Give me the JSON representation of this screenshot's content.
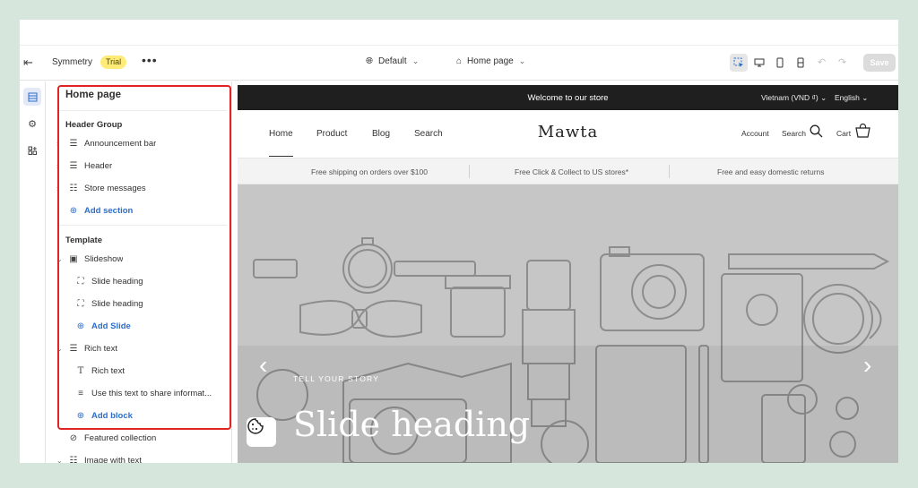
{
  "topbar": {
    "store_name": "Symmetry",
    "badge": "Trial",
    "more": "•••",
    "theme_select": "Default",
    "page_select": "Home page",
    "save_label": "Save",
    "icons": [
      "exit-icon",
      "globe-icon",
      "home-icon",
      "inspector-icon",
      "desktop-icon",
      "mobile-icon",
      "fullscreen-icon",
      "undo-icon",
      "redo-icon"
    ]
  },
  "panel": {
    "title": "Home page",
    "header_group": {
      "label": "Header Group",
      "items": [
        {
          "label": "Announcement bar",
          "icon": "announcement-icon"
        },
        {
          "label": "Header",
          "icon": "header-icon"
        },
        {
          "label": "Store messages",
          "icon": "store-messages-icon"
        }
      ],
      "add_label": "Add section"
    },
    "template": {
      "label": "Template",
      "slideshow": {
        "label": "Slideshow",
        "children": [
          "Slide heading",
          "Slide heading"
        ],
        "add_label": "Add Slide"
      },
      "rich_text": {
        "label": "Rich text",
        "children": [
          "Rich text",
          "Use this text to share informat..."
        ],
        "add_label": "Add block"
      },
      "more_sections": [
        "Featured collection",
        "Image with text"
      ]
    }
  },
  "preview": {
    "announcement": "Welcome to our store",
    "locale": "Vietnam (VND ₫)",
    "language": "English",
    "nav": [
      "Home",
      "Product",
      "Blog",
      "Search"
    ],
    "logo": "Mawta",
    "account": "Account",
    "search": "Search",
    "cart": "Cart",
    "usps": [
      "Free shipping on orders over $100",
      "Free Click & Collect to US stores*",
      "Free and easy domestic returns"
    ],
    "hero_subheading": "TELL YOUR STORY",
    "hero_heading": "Slide heading"
  },
  "colors": {
    "accent": "#2c6ecb",
    "highlight": "#e02424",
    "badge": "#ffeb78",
    "announcement_bg": "#1f1f1f",
    "hero_bg": "#c6c6c6"
  }
}
